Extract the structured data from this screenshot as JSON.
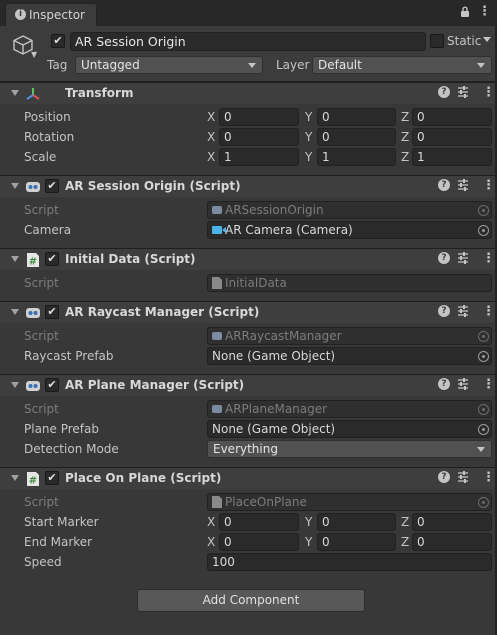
{
  "tab": {
    "title": "Inspector"
  },
  "gameobject": {
    "name": "AR Session Origin",
    "active": true,
    "static_label": "Static",
    "tag_label": "Tag",
    "tag_value": "Untagged",
    "layer_label": "Layer",
    "layer_value": "Default"
  },
  "transform": {
    "title": "Transform",
    "position": {
      "label": "Position",
      "x": "0",
      "y": "0",
      "z": "0"
    },
    "rotation": {
      "label": "Rotation",
      "x": "0",
      "y": "0",
      "z": "0"
    },
    "scale": {
      "label": "Scale",
      "x": "1",
      "y": "1",
      "z": "1"
    }
  },
  "axes": {
    "x": "X",
    "y": "Y",
    "z": "Z"
  },
  "ar_session_origin": {
    "title": "AR Session Origin (Script)",
    "script_label": "Script",
    "script_value": "ARSessionOrigin",
    "camera_label": "Camera",
    "camera_value": "AR Camera (Camera)"
  },
  "initial_data": {
    "title": "Initial Data (Script)",
    "script_label": "Script",
    "script_value": "InitialData"
  },
  "ar_raycast_manager": {
    "title": "AR Raycast Manager (Script)",
    "script_label": "Script",
    "script_value": "ARRaycastManager",
    "prefab_label": "Raycast Prefab",
    "prefab_value": "None (Game Object)"
  },
  "ar_plane_manager": {
    "title": "AR Plane Manager (Script)",
    "script_label": "Script",
    "script_value": "ARPlaneManager",
    "prefab_label": "Plane Prefab",
    "prefab_value": "None (Game Object)",
    "detection_label": "Detection Mode",
    "detection_value": "Everything"
  },
  "place_on_plane": {
    "title": "Place On Plane (Script)",
    "script_label": "Script",
    "script_value": "PlaceOnPlane",
    "start_marker": {
      "label": "Start Marker",
      "x": "0",
      "y": "0",
      "z": "0"
    },
    "end_marker": {
      "label": "End Marker",
      "x": "0",
      "y": "0",
      "z": "0"
    },
    "speed_label": "Speed",
    "speed_value": "100"
  },
  "add_component_label": "Add Component",
  "colors": {
    "panel_bg": "#383838",
    "header_bg": "#3e3e3e",
    "field_bg": "#2a2a2a",
    "text": "#c4c4c4",
    "camera_icon": "#4ab3ea",
    "transform_x": "#e05050",
    "transform_y": "#5cc85c",
    "transform_z": "#4f8ee0"
  },
  "icons": {
    "tab": "info-icon",
    "lock": "lock-icon",
    "menu": "kebab-menu-icon",
    "gameobject": "cube-icon",
    "transform": "transform-axes-icon",
    "component_script": "script-robot-icon",
    "csharp": "csharp-script-icon",
    "help": "help-icon",
    "presets": "presets-icon"
  }
}
